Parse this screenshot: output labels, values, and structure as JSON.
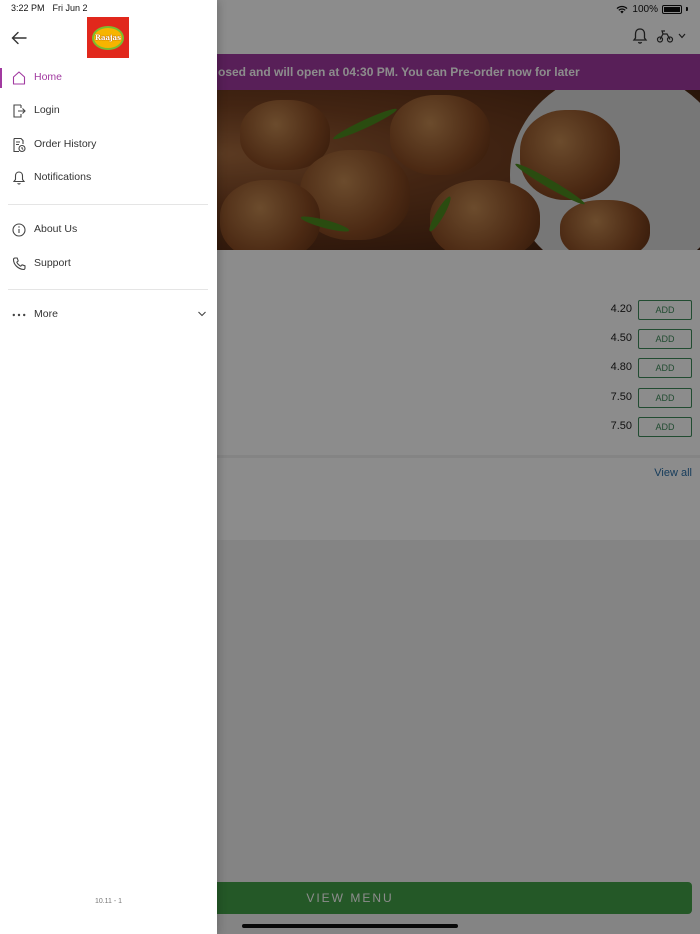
{
  "status_bar": {
    "time": "3:22 PM",
    "date": "Fri Jun 2",
    "battery": "100%"
  },
  "banner": {
    "text": "osed and will open at 04:30 PM. You can Pre-order now for later"
  },
  "menu_items": [
    {
      "price": "4.20",
      "button": "ADD"
    },
    {
      "price": "4.50",
      "button": "ADD"
    },
    {
      "price": "4.80",
      "button": "ADD"
    },
    {
      "price": "7.50",
      "button": "ADD"
    },
    {
      "price": "7.50",
      "button": "ADD"
    }
  ],
  "section": {
    "view_all": "View all"
  },
  "view_menu_button": "VIEW MENU",
  "drawer": {
    "logo_text": "Raajas",
    "items": [
      {
        "label": "Home",
        "icon": "home-icon",
        "active": true
      },
      {
        "label": "Login",
        "icon": "login-icon",
        "active": false
      },
      {
        "label": "Order History",
        "icon": "order-history-icon",
        "active": false
      },
      {
        "label": "Notifications",
        "icon": "bell-icon",
        "active": false
      },
      {
        "label": "About Us",
        "icon": "info-icon",
        "active": false
      },
      {
        "label": "Support",
        "icon": "phone-icon",
        "active": false
      },
      {
        "label": "More",
        "icon": "more-dots-icon",
        "active": false
      }
    ],
    "version": "10.11 - 1"
  },
  "colors": {
    "accent": "#a13aa0",
    "button_green": "#43a047",
    "add_green": "#3d8a5a",
    "link_blue": "#2b6fa8",
    "logo_red": "#e1281c"
  }
}
